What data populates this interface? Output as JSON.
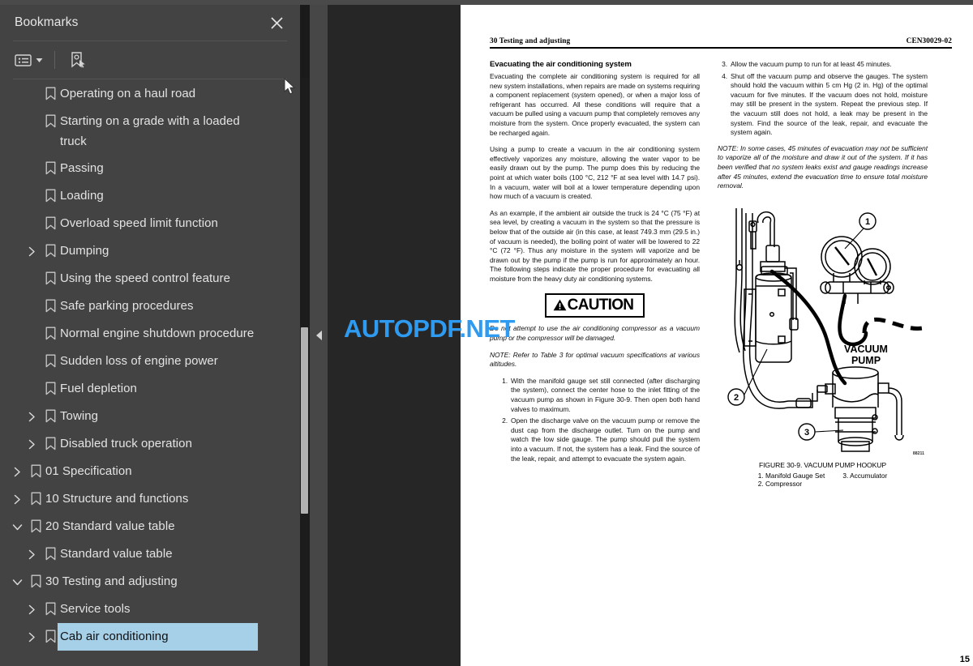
{
  "panel": {
    "title": "Bookmarks",
    "close_icon": "close-icon",
    "toolbar": {
      "list_options_icon": "list-options-icon",
      "caret_icon": "chevron-down-icon",
      "new_bookmark_icon": "new-bookmark-icon"
    }
  },
  "bookmarks": [
    {
      "label": "Operating on a haul road",
      "level": 1,
      "twisty": "none"
    },
    {
      "label": "Starting on a grade with a loaded\ntruck",
      "level": 1,
      "twisty": "none",
      "wrap": true
    },
    {
      "label": "Passing",
      "level": 1,
      "twisty": "none"
    },
    {
      "label": "Loading",
      "level": 1,
      "twisty": "none"
    },
    {
      "label": "Overload speed limit function",
      "level": 1,
      "twisty": "none"
    },
    {
      "label": "Dumping",
      "level": 1,
      "twisty": "collapsed"
    },
    {
      "label": "Using the speed control feature",
      "level": 1,
      "twisty": "none"
    },
    {
      "label": "Safe parking procedures",
      "level": 1,
      "twisty": "none"
    },
    {
      "label": "Normal engine shutdown procedure",
      "level": 1,
      "twisty": "none"
    },
    {
      "label": "Sudden loss of engine power",
      "level": 1,
      "twisty": "none"
    },
    {
      "label": "Fuel depletion",
      "level": 1,
      "twisty": "none"
    },
    {
      "label": "Towing",
      "level": 1,
      "twisty": "collapsed"
    },
    {
      "label": "Disabled truck operation",
      "level": 1,
      "twisty": "collapsed"
    },
    {
      "label": "01 Specification",
      "level": 0,
      "twisty": "collapsed"
    },
    {
      "label": "10 Structure and functions",
      "level": 0,
      "twisty": "collapsed"
    },
    {
      "label": "20 Standard value table",
      "level": 0,
      "twisty": "expanded"
    },
    {
      "label": "Standard value table",
      "level": 1,
      "twisty": "collapsed"
    },
    {
      "label": "30 Testing and adjusting",
      "level": 0,
      "twisty": "expanded"
    },
    {
      "label": "Service tools",
      "level": 1,
      "twisty": "collapsed"
    },
    {
      "label": "Cab air conditioning",
      "level": 1,
      "twisty": "collapsed",
      "selected": true
    }
  ],
  "watermark": {
    "text": "AUTOPDF.NET",
    "color": "#2f9bf0"
  },
  "document": {
    "header": {
      "left": "30 Testing and adjusting",
      "right": "CEN30029-02"
    },
    "page_number": "15",
    "left_column": {
      "section_title": "Evacuating the air conditioning system",
      "paragraph_1": "Evacuating the complete air conditioning system is required for all new system installations, when repairs are made on systems requiring a component replacement (system opened), or when a major loss of refrigerant has occurred. All these conditions will require that a vacuum be pulled using a vacuum pump that completely removes any moisture from the system. Once properly evacuated, the system can be recharged again.",
      "paragraph_2": "Using a pump to create a vacuum in the air conditioning system effectively vaporizes any moisture, allowing the water vapor to be easily drawn out by the pump. The pump does this by reducing the point at which water boils (100 °C, 212 °F at sea level with 14.7 psi). In a vacuum, water will boil at a lower temperature depending upon how much of a vacuum is created.",
      "paragraph_3": "As an example, if the ambient air outside the truck is 24 °C (75 °F) at sea level, by creating a vacuum in the system so that the pressure is below that of the outside air (in this case, at least 749.3 mm (29.5 in.) of vacuum is needed), the boiling point of water will be lowered to 22 °C (72 °F). Thus any moisture in the system will vaporize and be drawn out by the pump if the pump is run for approximately an hour. The following steps indicate the proper procedure for evacuating all moisture from the heavy duty air conditioning systems.",
      "caution_label": "CAUTION",
      "caution_body": "Do not attempt to use the air conditioning compressor as a vacuum pump or the compressor will be damaged.",
      "note": "NOTE: Refer to Table 3 for optimal vacuum specifications at various altitudes.",
      "steps": [
        {
          "num": "1.",
          "text": "With the manifold gauge set still connected (after discharging the system), connect the center hose to the inlet fitting of the vacuum pump as shown in Figure 30-9. Then open both hand valves to maximum."
        },
        {
          "num": "2.",
          "text": "Open the discharge valve on the vacuum pump or remove the dust cap from the discharge outlet. Turn on the pump and watch the low side gauge. The pump should pull the system into a vacuum. If not, the system has a leak. Find the source of the leak, repair, and attempt to evacuate the system again."
        }
      ]
    },
    "right_column": {
      "steps": [
        {
          "num": "3.",
          "text": "Allow the vacuum pump to run for at least 45 minutes."
        },
        {
          "num": "4.",
          "text": "Shut off the vacuum pump and observe the gauges. The system should hold the vacuum within 5 cm Hg (2 in. Hg) of the optimal vacuum for five minutes. If the vacuum does not hold, moisture may still be present in the system. Repeat the previous step. If the vacuum still does not hold, a leak may be present in the system. Find the source of the leak, repair, and evacuate the system again."
        }
      ],
      "note": "NOTE: In some cases, 45 minutes of evacuation may not be sufficient to vaporize all of the moisture and draw it out of the system. If it has been verified that no system leaks exist and gauge readings increase after 45 minutes, extend the evacuation time to ensure total moisture removal.",
      "figure": {
        "callout_1": "1",
        "callout_2": "2",
        "callout_3": "3",
        "inline_label": "VACUUM\nPUMP",
        "code": "88211",
        "caption": "FIGURE 30-9. VACUUM PUMP HOOKUP",
        "legend_col1": "1. Manifold Gauge Set\n2. Compressor",
        "legend_col2": "3. Accumulator"
      }
    }
  },
  "splitter": {
    "collapse_icon": "collapse-left-icon"
  }
}
